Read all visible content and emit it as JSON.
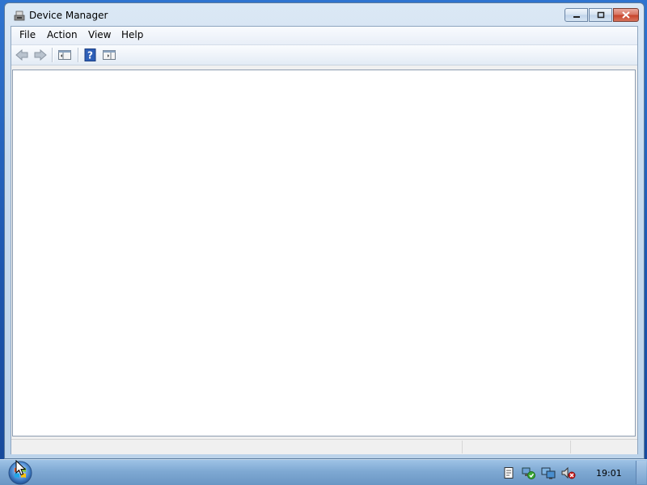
{
  "window": {
    "title": "Device Manager",
    "icon": "device-manager-icon",
    "caption_buttons": [
      "minimize",
      "maximize",
      "close"
    ]
  },
  "menubar": {
    "items": [
      {
        "label": "File"
      },
      {
        "label": "Action"
      },
      {
        "label": "View"
      },
      {
        "label": "Help"
      }
    ]
  },
  "toolbar": {
    "buttons": [
      "back-arrow-icon",
      "forward-arrow-icon",
      "show-hide-console-tree-icon",
      "help-icon",
      "show-hide-action-pane-icon"
    ]
  },
  "taskbar": {
    "clock": "19:01",
    "tray_icons": [
      "action-center-icon",
      "network-icon",
      "display-icon",
      "volume-muted-icon"
    ]
  },
  "colors": {
    "desktop": "#1c56ae",
    "window_frame": "#c9dcef",
    "close_button": "#c8462d",
    "content_bg": "#ffffff"
  }
}
